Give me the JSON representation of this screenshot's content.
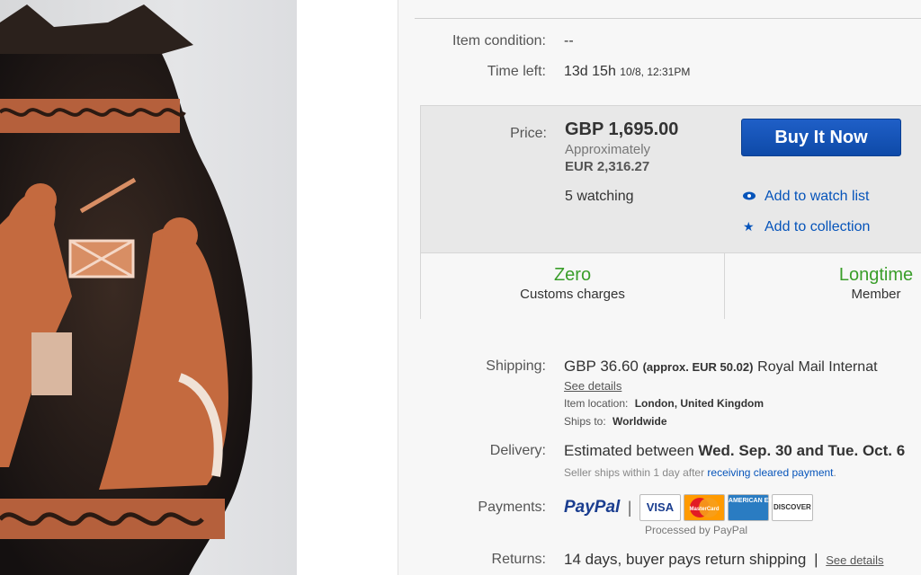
{
  "item": {
    "condition_label": "Item condition:",
    "condition_value": "--",
    "time_left_label": "Time left:",
    "time_left_value": "13d 15h",
    "time_left_end": "10/8, 12:31PM"
  },
  "price": {
    "label": "Price:",
    "value": "GBP 1,695.00",
    "approx_label": "Approximately",
    "approx_value": "EUR 2,316.27",
    "watching": "5 watching",
    "buy_button": "Buy It Now",
    "watch_link": "Add to watch list",
    "collection_link": "Add to collection"
  },
  "stats": {
    "customs_title": "Zero",
    "customs_sub": "Customs charges",
    "member_title": "Longtime",
    "member_sub": "Member"
  },
  "shipping": {
    "label": "Shipping:",
    "value": "GBP 36.60",
    "approx": "(approx. EUR 50.02)",
    "service": "Royal Mail Internat",
    "see_details": "See details",
    "location_label": "Item location:",
    "location_value": "London, United Kingdom",
    "ships_label": "Ships to:",
    "ships_value": "Worldwide"
  },
  "delivery": {
    "label": "Delivery:",
    "text": "Estimated between",
    "dates": "Wed. Sep. 30 and Tue. Oct. 6",
    "note_prefix": "Seller ships within 1 day after",
    "note_link": "receiving cleared payment",
    "note_suffix": "."
  },
  "payments": {
    "label": "Payments:",
    "paypal": "PayPal",
    "separator": "|",
    "cards": [
      "VISA",
      "MasterCard",
      "AMERICAN EXPRESS",
      "DISCOVER"
    ],
    "processed": "Processed by PayPal"
  },
  "returns": {
    "label": "Returns:",
    "text": "14 days, buyer pays return shipping",
    "separator": "|",
    "see_details": "See details"
  },
  "colors": {
    "buy_button": "#0e4aa8",
    "link": "#0654ba",
    "stat_green": "#3a9e2a"
  },
  "icons": {
    "watch": "eye-icon",
    "collection": "star-icon"
  }
}
